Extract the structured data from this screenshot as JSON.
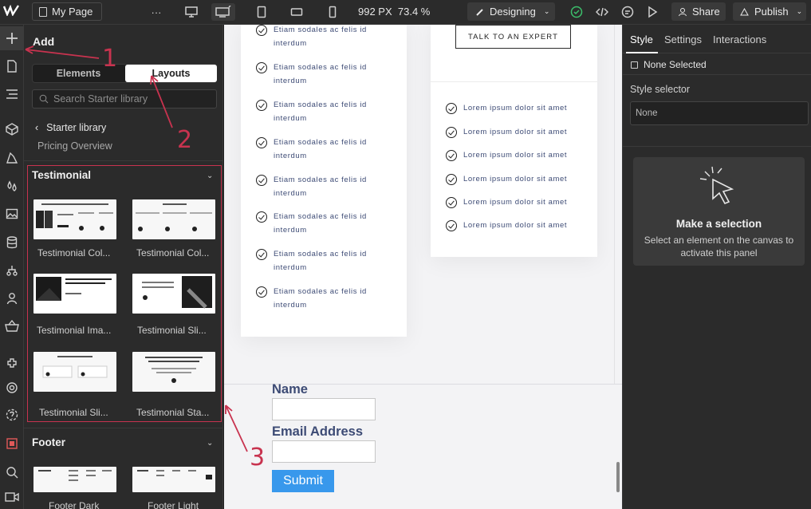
{
  "topbar": {
    "page_name": "My Page",
    "more": "···",
    "canvas_width": "992 PX",
    "zoom": "73.4 %",
    "mode": "Designing",
    "share": "Share",
    "publish": "Publish"
  },
  "add_panel": {
    "title": "Add",
    "tab_elements": "Elements",
    "tab_layouts": "Layouts",
    "search_placeholder": "Search Starter library",
    "crumb": "Starter library",
    "sub_item": "Pricing Overview",
    "section_testimonial": "Testimonial",
    "testimonials": [
      {
        "label": "Testimonial Col..."
      },
      {
        "label": "Testimonial Col..."
      },
      {
        "label": "Testimonial Ima..."
      },
      {
        "label": "Testimonial Sli..."
      },
      {
        "label": "Testimonial Sli..."
      },
      {
        "label": "Testimonial Sta..."
      }
    ],
    "section_footer": "Footer",
    "footers": [
      {
        "label": "Footer Dark"
      },
      {
        "label": "Footer Light"
      }
    ]
  },
  "canvas": {
    "left_items": [
      "Etiam sodales ac felis id interdum",
      "Etiam sodales ac felis id interdum",
      "Etiam sodales ac felis id interdum",
      "Etiam sodales ac felis id interdum",
      "Etiam sodales ac felis id interdum",
      "Etiam sodales ac felis id interdum",
      "Etiam sodales ac felis id interdum",
      "Etiam sodales ac felis id interdum"
    ],
    "expert_button": "TALK TO AN EXPERT",
    "right_items": [
      "Lorem ipsum dolor sit amet",
      "Lorem ipsum dolor sit amet",
      "Lorem ipsum dolor sit amet",
      "Lorem ipsum dolor sit amet",
      "Lorem ipsum dolor sit amet",
      "Lorem ipsum dolor sit amet"
    ],
    "form": {
      "name_label": "Name",
      "email_label": "Email Address",
      "submit": "Submit"
    }
  },
  "right_panel": {
    "tabs": [
      "Style",
      "Settings",
      "Interactions"
    ],
    "none_selected": "None Selected",
    "style_selector_label": "Style selector",
    "style_selector_value": "None",
    "make_selection_title": "Make a selection",
    "make_selection_desc": "Select an element on the canvas to activate this panel"
  },
  "annotations": [
    "1",
    "2",
    "3"
  ],
  "colors": {
    "annotation": "#c8334f",
    "submit": "#3898ec",
    "form_text": "#3d4b75"
  }
}
